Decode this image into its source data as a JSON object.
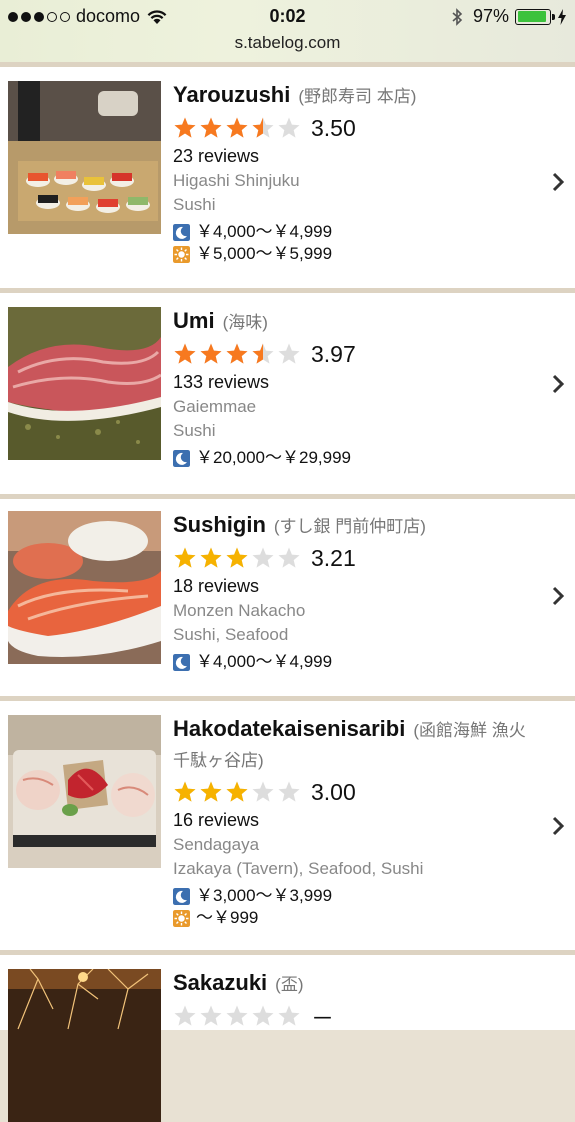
{
  "status": {
    "carrier": "docomo",
    "time": "0:02",
    "battery": "97%",
    "signal_bars_filled": 3,
    "signal_bars_total": 5
  },
  "browser": {
    "url": "s.tabelog.com"
  },
  "colors": {
    "star_orange": "#f7791f",
    "star_gold": "#f6b200",
    "star_empty": "#dddddd",
    "dinner_icon": "#3c6fb0",
    "lunch_icon": "#e99a2c"
  },
  "restaurants": [
    {
      "name": "Yarouzushi",
      "jp_name": "(野郎寿司 本店)",
      "rating": 3.5,
      "rating_text": "3.50",
      "reviews": "23 reviews",
      "area": "Higashi Shinjuku",
      "genre": "Sushi",
      "dinner_price": "￥4,000～￥4,999",
      "lunch_price": "￥5,000～￥5,999"
    },
    {
      "name": "Umi",
      "jp_name": "(海味)",
      "rating": 3.97,
      "rating_text": "3.97",
      "reviews": "133 reviews",
      "area": "Gaiemmae",
      "genre": "Sushi",
      "dinner_price": "￥20,000～￥29,999"
    },
    {
      "name": "Sushigin",
      "jp_name": "(すし銀 門前仲町店)",
      "rating": 3.21,
      "rating_text": "3.21",
      "reviews": "18 reviews",
      "area": "Monzen Nakacho",
      "genre": "Sushi, Seafood",
      "dinner_price": "￥4,000～￥4,999"
    },
    {
      "name": "Hakodatekaisenisaribi",
      "jp_name": "(函館海鮮 漁火 千駄ヶ谷店)",
      "rating": 3.0,
      "rating_text": "3.00",
      "reviews": "16 reviews",
      "area": "Sendagaya",
      "genre": "Izakaya (Tavern), Seafood, Sushi",
      "dinner_price": "￥3,000～￥3,999",
      "lunch_price": "～￥999"
    },
    {
      "name": "Sakazuki",
      "jp_name": "(盃)",
      "rating_text": "－"
    }
  ]
}
